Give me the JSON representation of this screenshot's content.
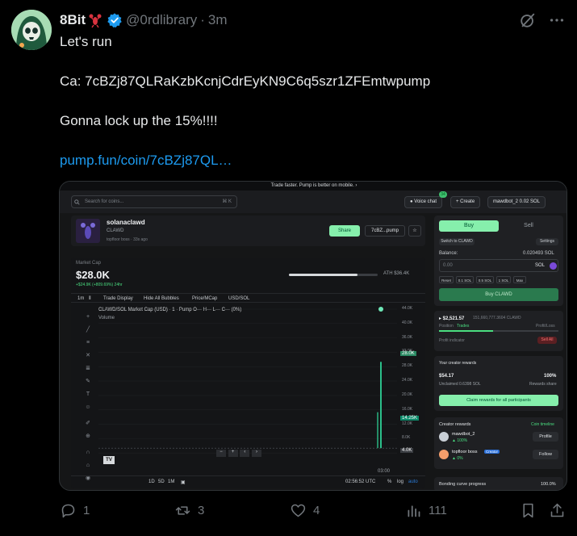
{
  "author": {
    "name": "8Bit",
    "handle": "@0rdlibrary",
    "time": "3m",
    "verified": true,
    "avatar_icon": "skull-hood-avatar",
    "name_emoji": "lobster-icon"
  },
  "tweet": {
    "line1": "Let's run",
    "line2": "Ca: 7cBZj87QLRaKzbKcnjCdrEyKN9C6q5szr1ZFEmtwpump",
    "line3": "Gonna lock up the 15%!!!!",
    "link": "pump.fun/coin/7cBZj87QL…"
  },
  "actions": {
    "replies": "1",
    "reposts": "3",
    "likes": "4",
    "views": "111"
  },
  "screenshot": {
    "banner": "Trade faster. Pump is better on mobile.  ›",
    "search_placeholder": "Search for coins...",
    "search_shortcut": "⌘ K",
    "voice_chat": "Voice chat",
    "voice_badge": "34",
    "create": "+ Create",
    "wallet": "mawdbot_2  0.02 SOL",
    "coin_name": "solanaclawd",
    "coin_ticker": "CLAWD",
    "creator_line": "topfloor boss · 33s ago",
    "share": "Share",
    "ca_short": "7cBZ...pump",
    "market_cap_label": "Market Cap",
    "market_cap": "$28.0K",
    "change": "+$24.9K (+809.69%) 24hr",
    "ath": "ATH $36.4K",
    "chart_tabs": [
      "1m",
      "Trade Display",
      "Hide All Bubbles",
      "Price/MCap",
      "USD/SOL"
    ],
    "chart_title": "CLAWD/SOL Market Cap (USD) · 1 · Pump  O— H— L— C— (0%)",
    "volume_label": "Volume",
    "y_ticks": [
      "44.0K",
      "40.0K",
      "36.0K",
      "32.0K",
      "28.0K",
      "24.0K",
      "20.0K",
      "16.0K",
      "12.0K",
      "8.0K",
      "4.0K"
    ],
    "price_tag_1": "28.0K",
    "price_tag_2": "14.25K",
    "price_tag_3": "4.0K",
    "x_time": "03:00",
    "ranges": [
      "1D",
      "5D",
      "1M"
    ],
    "clock": "02:56:52 UTC",
    "scale_opts": [
      "%",
      "log",
      "auto"
    ],
    "buy_tab": "Buy",
    "sell_tab": "Sell",
    "switch_btn": "Switch to CLAWD",
    "settings_btn": "Settings",
    "balance_label": "Balance:",
    "balance_value": "0.020493 SOL",
    "amount_placeholder": "0.00",
    "amount_unit": "SOL",
    "quick_amounts": [
      "Reset",
      "0.1 SOL",
      "0.5 SOL",
      "1 SOL",
      "Max"
    ],
    "buy_button": "Buy CLAWD",
    "position_value": "▸ $2,521.57",
    "position_tokens": "151,660,777.3604 CLAWD",
    "position_label": "Position",
    "trades_label": "Trades",
    "pnl_label": "Profit/Loss",
    "profit_indicator": "Profit indicator",
    "sell_all": "Sell All",
    "rewards_title": "Your creator rewards",
    "rewards_value": "$54.17",
    "rewards_pct": "100%",
    "unclaimed": "Unclaimed 0.6398 SOL",
    "rewards_share": "Rewards share",
    "claim_button": "Claim rewards for all participants",
    "creator_rewards_title": "Creator rewards",
    "coin_timeline": "Coin timeline",
    "creators": [
      {
        "name": "mawdbot_2",
        "pct": "▲ 100%",
        "button": "Profile"
      },
      {
        "name": "topfloor boss",
        "badge": "Creator",
        "pct": "▲ 0%",
        "button": "Follow"
      }
    ],
    "bonding_label": "Bonding curve progress",
    "bonding_value": "100.0%"
  },
  "chart_data": {
    "type": "line",
    "title": "CLAWD/SOL Market Cap (USD) · 1 · Pump",
    "ylabel": "",
    "ylim": [
      0,
      44000
    ],
    "x": [
      "02:56"
    ],
    "series": [
      {
        "values": [
          4000,
          28000
        ]
      }
    ]
  },
  "colors": {
    "accent_green": "#4ade80",
    "link_blue": "#1d9bf0",
    "verified_blue": "#1d9bf0",
    "muted": "#71767b"
  }
}
